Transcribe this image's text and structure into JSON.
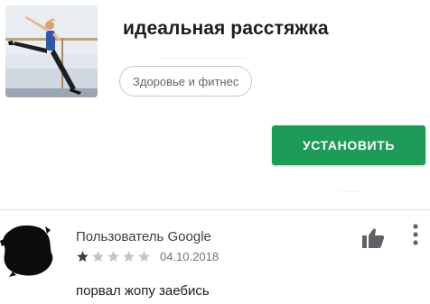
{
  "app": {
    "title": "идеальная расстяжка",
    "category": "Здоровье и фитнес",
    "install_label": "УСТАНОВИТЬ"
  },
  "review": {
    "author": "Пользователь Google",
    "rating": 1,
    "max_rating": 5,
    "date": "04.10.2018",
    "text": "порвал жопу заебись"
  },
  "icons": {
    "app_icon": "ballet-stretch-photo",
    "avatar": "redacted-avatar",
    "like": "thumbs-up-icon",
    "more": "more-vert-icon",
    "star": "star-icon"
  },
  "colors": {
    "install_button": "#1e9b58",
    "star_filled": "#3c4043",
    "star_empty": "#c4c4c4",
    "divider": "#e2e2e2"
  }
}
